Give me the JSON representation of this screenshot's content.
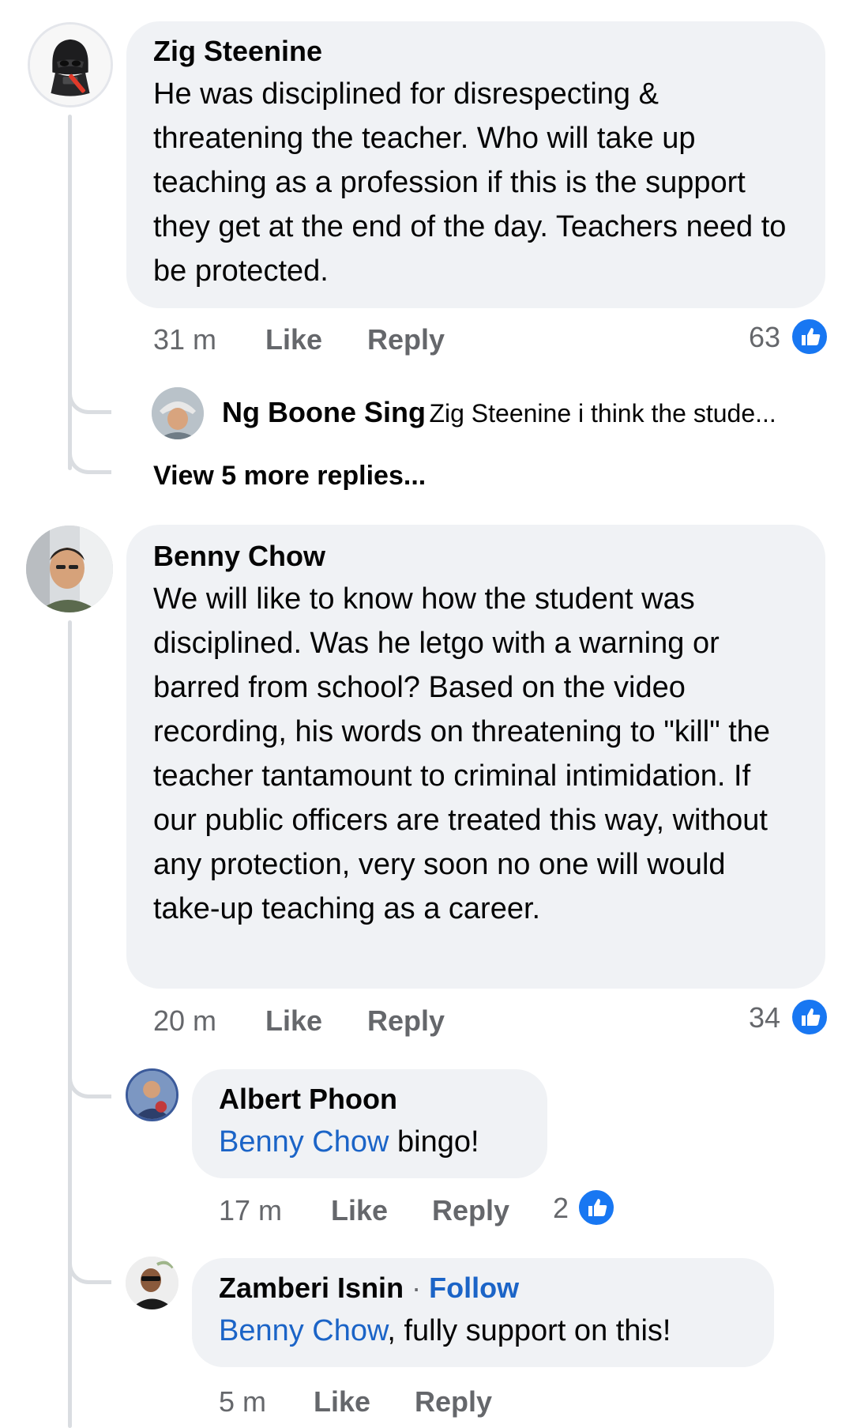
{
  "comments": [
    {
      "author": "Zig Steenine",
      "avatar_icon": "darth-vader-figure-avatar",
      "text": "He was disciplined for disrespecting & threatening the teacher. Who will take up teaching as a profession if this is the support they get at the end of the day. Teachers need to be protected.",
      "time": "31 m",
      "like_label": "Like",
      "reply_label": "Reply",
      "reaction_count": "63",
      "reply_preview": {
        "author": "Ng Boone Sing",
        "snippet": "Zig Steenine i think the stude..."
      },
      "view_more_label": "View 5 more replies..."
    },
    {
      "author": "Benny Chow",
      "avatar_icon": "person-photo-avatar",
      "text": "We will like to know how the student was disciplined. Was he letgo with a warning or barred from school? Based on the video recording, his words on threatening to \"kill\" the teacher tantamount to criminal intimidation. If our public officers are treated this way, without any protection, very soon no one will would take-up teaching as a career.",
      "time": "20 m",
      "like_label": "Like",
      "reply_label": "Reply",
      "reaction_count": "34",
      "replies": [
        {
          "author": "Albert Phoon",
          "mention": "Benny Chow",
          "text": " bingo!",
          "time": "17 m",
          "like_label": "Like",
          "reply_label": "Reply",
          "reaction_count": "2"
        },
        {
          "author": "Zamberi Isnin",
          "follow_separator": "·",
          "follow_label": "Follow",
          "mention": "Benny Chow",
          "text": ", fully support on this!",
          "time": "5 m",
          "like_label": "Like",
          "reply_label": "Reply"
        }
      ]
    }
  ],
  "colors": {
    "bubble": "#f0f2f5",
    "link": "#1b64c7",
    "meta": "#65676b",
    "like_badge": "#1877f2",
    "thread_line": "#dadde1"
  },
  "icons": {
    "reaction": "thumbs-up-icon"
  }
}
